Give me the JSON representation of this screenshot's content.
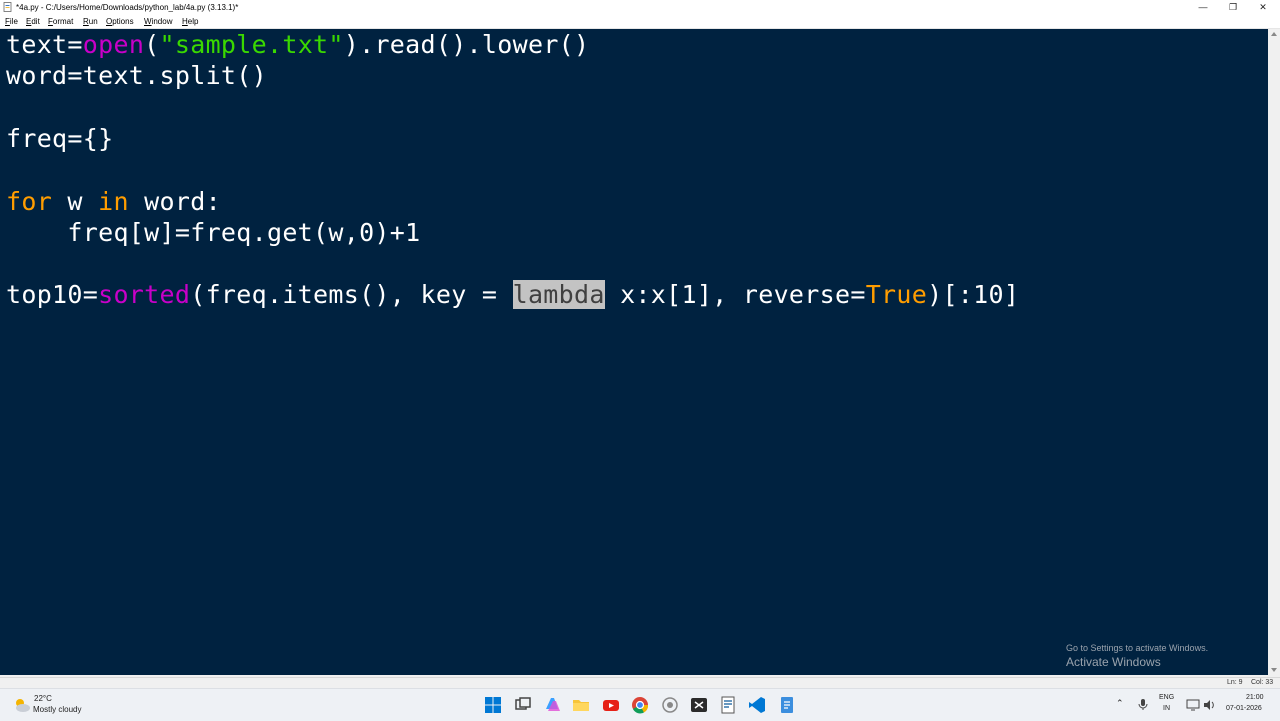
{
  "window": {
    "title": "*4a.py - C:/Users/Home/Downloads/python_lab/4a.py (3.13.1)*",
    "minimize": "—",
    "maximize": "❐",
    "close": "✕"
  },
  "menu": {
    "items": [
      "File",
      "Edit",
      "Format",
      "Run",
      "Options",
      "Window",
      "Help"
    ]
  },
  "editor": {
    "line1": {
      "a": "text=",
      "b": "open",
      "c": "(",
      "d": "\"sample.txt\"",
      "e": ").read().lower()"
    },
    "line2": "word=text.split()",
    "line3": "freq={}",
    "line4": {
      "kw1": "for",
      "a": " w ",
      "kw2": "in",
      "b": " word:"
    },
    "line5": "    freq[w]=freq.get(w,0)+1",
    "line6": {
      "a": "top10=",
      "b": "sorted",
      "c": "(freq.items(), key = ",
      "sel": "lambda",
      "d": " x:x[1], reverse=",
      "kw": "True",
      "e": ")[:10]"
    }
  },
  "status": {
    "ln": "Ln: 9",
    "col": "Col: 33"
  },
  "watermark": {
    "title": "Activate Windows",
    "sub": "Go to Settings to activate Windows."
  },
  "taskbar": {
    "temp": "22°C",
    "condition": "Mostly cloudy",
    "lang1": "ENG",
    "lang2": "IN",
    "time": "21:00",
    "date": "07-01-2026"
  },
  "colors": {
    "editor_bg": "#002240",
    "keyword": "#ff9d00",
    "builtin": "#c800c8",
    "string": "#3ad900",
    "selection": "#c3c3c3"
  }
}
